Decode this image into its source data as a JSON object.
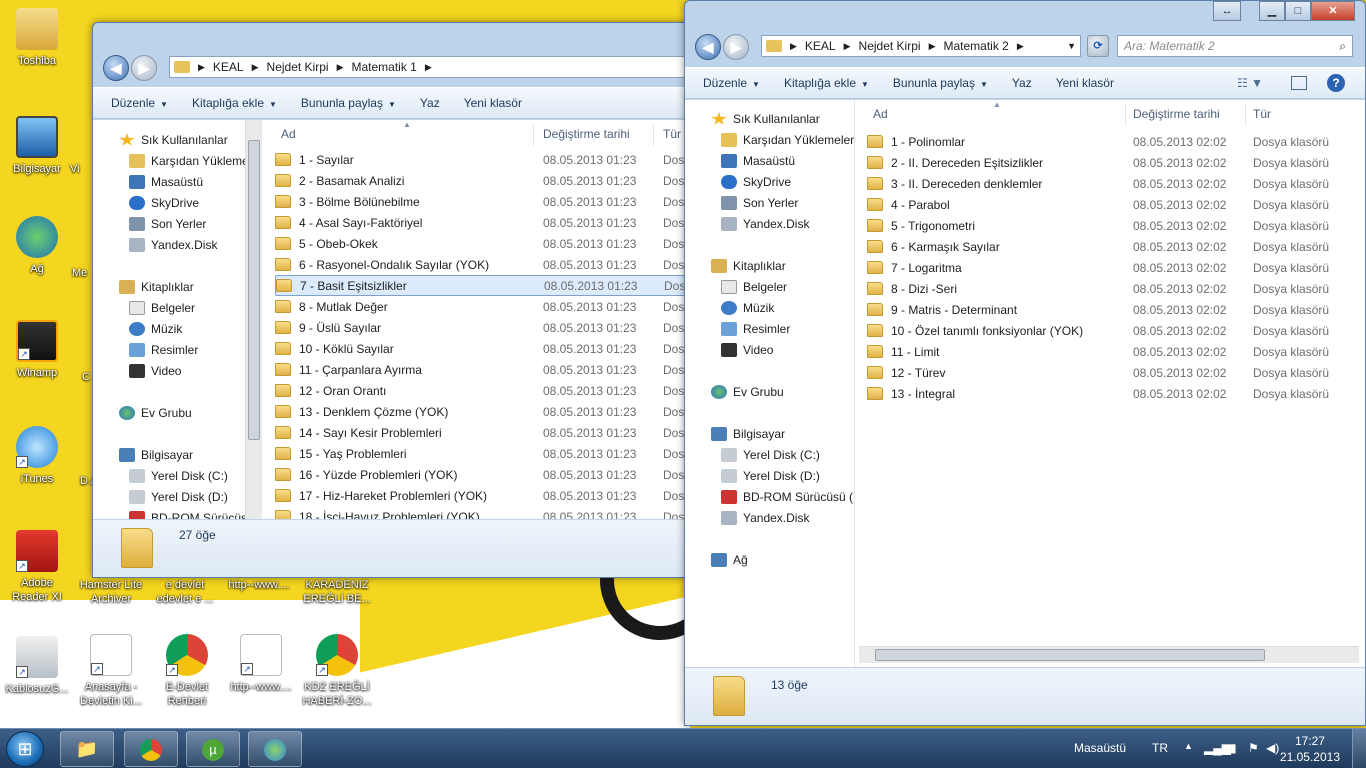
{
  "desktop": {
    "icons_left": [
      {
        "label": "Toshiba",
        "icon": "user-folder-icon"
      },
      {
        "label": "Bilgisayar",
        "icon": "computer-icon"
      },
      {
        "label": "Ağ",
        "icon": "network-icon"
      },
      {
        "label": "Winamp",
        "icon": "winamp-icon"
      },
      {
        "label": "iTunes",
        "icon": "itunes-icon"
      },
      {
        "label": "Adobe Reader XI",
        "icon": "pdf-icon"
      },
      {
        "label": "KablosuzG...",
        "icon": "wireless-icon"
      }
    ],
    "icons_bottom": [
      {
        "label": "Hamster Lite Archiver",
        "icon": "archive-icon"
      },
      {
        "label": "e devlet edevlet e ...",
        "icon": "shortcut-icon"
      },
      {
        "label": "http--www....",
        "icon": "web-shortcut-icon"
      },
      {
        "label": "KARADENIZ EREĞLİ BE...",
        "icon": "web-shortcut-icon"
      },
      {
        "label": "Anasayfa - Devletin Ki...",
        "icon": "web-shortcut-icon"
      },
      {
        "label": "E-Devlet Rehberi",
        "icon": "chrome-icon"
      },
      {
        "label": "http--www....",
        "icon": "web-shortcut-icon"
      },
      {
        "label": "KDZ EREĞLİ HABERİ-ZO...",
        "icon": "chrome-icon"
      }
    ],
    "partial_labels": [
      "Vi",
      "Me",
      "C",
      "D A"
    ]
  },
  "window1": {
    "breadcrumb": [
      "KEAL",
      "Nejdet Kirpi",
      "Matematik 1"
    ],
    "toolbar": [
      "Düzenle",
      "Kitaplığa ekle",
      "Bununla paylaş",
      "Yaz",
      "Yeni klasör"
    ],
    "nav": {
      "favorites_label": "Sık Kullanılanlar",
      "favorites": [
        "Karşıdan Yükleme",
        "Masaüstü",
        "SkyDrive",
        "Son Yerler",
        "Yandex.Disk"
      ],
      "libraries_label": "Kitaplıklar",
      "libraries": [
        "Belgeler",
        "Müzik",
        "Resimler",
        "Video"
      ],
      "homegroup_label": "Ev Grubu",
      "computer_label": "Bilgisayar",
      "computer": [
        "Yerel Disk (C:)",
        "Yerel Disk (D:)",
        "BD-ROM Sürücüsü"
      ]
    },
    "columns": {
      "name": "Ad",
      "date": "Değiştirme tarihi",
      "type": "Tür"
    },
    "rows": [
      {
        "name": "1 - Sayılar",
        "date": "08.05.2013 01:23",
        "type": "Dos"
      },
      {
        "name": "2 - Basamak Analizi",
        "date": "08.05.2013 01:23",
        "type": "Dos"
      },
      {
        "name": "3 - Bölme Bölünebilme",
        "date": "08.05.2013 01:23",
        "type": "Dos"
      },
      {
        "name": "4 - Asal Sayı-Faktöriyel",
        "date": "08.05.2013 01:23",
        "type": "Dos"
      },
      {
        "name": "5 - Obeb-Okek",
        "date": "08.05.2013 01:23",
        "type": "Dos"
      },
      {
        "name": "6 - Rasyonel-Ondalık Sayılar  (YOK)",
        "date": "08.05.2013 01:23",
        "type": "Dos"
      },
      {
        "name": "7 - Basit Eşitsizlikler",
        "date": "08.05.2013 01:23",
        "type": "Dos"
      },
      {
        "name": "8 - Mutlak Değer",
        "date": "08.05.2013 01:23",
        "type": "Dos"
      },
      {
        "name": "9 - Üslü Sayılar",
        "date": "08.05.2013 01:23",
        "type": "Dos"
      },
      {
        "name": "10 - Köklü Sayılar",
        "date": "08.05.2013 01:23",
        "type": "Dos"
      },
      {
        "name": "11 - Çarpanlara Ayırma",
        "date": "08.05.2013 01:23",
        "type": "Dos"
      },
      {
        "name": "12 - Oran Orantı",
        "date": "08.05.2013 01:23",
        "type": "Dos"
      },
      {
        "name": "13 - Denklem Çözme  (YOK)",
        "date": "08.05.2013 01:23",
        "type": "Dos"
      },
      {
        "name": "14 - Sayı Kesir Problemleri",
        "date": "08.05.2013 01:23",
        "type": "Dos"
      },
      {
        "name": "15 - Yaş Problemleri",
        "date": "08.05.2013 01:23",
        "type": "Dos"
      },
      {
        "name": "16 - Yüzde Problemleri (YOK)",
        "date": "08.05.2013 01:23",
        "type": "Dos"
      },
      {
        "name": "17 - Hiz-Hareket Problemleri  (YOK)",
        "date": "08.05.2013 01:23",
        "type": "Dos"
      },
      {
        "name": "18 - İşçi-Havuz Problemleri  (YOK)",
        "date": "08.05.2013 01:23",
        "type": "Dos"
      }
    ],
    "selected_row": "7 - Basit Eşitsizlikler",
    "status": "27 öğe"
  },
  "window2": {
    "breadcrumb": [
      "KEAL",
      "Nejdet Kirpi",
      "Matematik 2"
    ],
    "search_placeholder": "Ara: Matematik 2",
    "toolbar": [
      "Düzenle",
      "Kitaplığa ekle",
      "Bununla paylaş",
      "Yaz",
      "Yeni klasör"
    ],
    "nav": {
      "favorites_label": "Sık Kullanılanlar",
      "favorites": [
        "Karşıdan Yüklemeler",
        "Masaüstü",
        "SkyDrive",
        "Son Yerler",
        "Yandex.Disk"
      ],
      "libraries_label": "Kitaplıklar",
      "libraries": [
        "Belgeler",
        "Müzik",
        "Resimler",
        "Video"
      ],
      "homegroup_label": "Ev Grubu",
      "computer_label": "Bilgisayar",
      "computer": [
        "Yerel Disk (C:)",
        "Yerel Disk (D:)",
        "BD-ROM Sürücüsü (F",
        "Yandex.Disk"
      ],
      "network_label": "Ağ"
    },
    "columns": {
      "name": "Ad",
      "date": "Değiştirme tarihi",
      "type": "Tür"
    },
    "rows": [
      {
        "name": "1 - Polinomlar",
        "date": "08.05.2013 02:02",
        "type": "Dosya klasörü"
      },
      {
        "name": "2 - II. Dereceden Eşitsizlikler",
        "date": "08.05.2013 02:02",
        "type": "Dosya klasörü"
      },
      {
        "name": "3 - II. Dereceden denklemler",
        "date": "08.05.2013 02:02",
        "type": "Dosya klasörü"
      },
      {
        "name": "4 - Parabol",
        "date": "08.05.2013 02:02",
        "type": "Dosya klasörü"
      },
      {
        "name": "5 - Trigonometri",
        "date": "08.05.2013 02:02",
        "type": "Dosya klasörü"
      },
      {
        "name": "6 - Karmaşık Sayılar",
        "date": "08.05.2013 02:02",
        "type": "Dosya klasörü"
      },
      {
        "name": "7 - Logaritma",
        "date": "08.05.2013 02:02",
        "type": "Dosya klasörü"
      },
      {
        "name": "8 - Dizi -Seri",
        "date": "08.05.2013 02:02",
        "type": "Dosya klasörü"
      },
      {
        "name": "9 - Matris - Determinant",
        "date": "08.05.2013 02:02",
        "type": "Dosya klasörü"
      },
      {
        "name": "10 - Özel tanımlı fonksiyonlar (YOK)",
        "date": "08.05.2013 02:02",
        "type": "Dosya klasörü"
      },
      {
        "name": "11 - Limit",
        "date": "08.05.2013 02:02",
        "type": "Dosya klasörü"
      },
      {
        "name": "12 - Türev",
        "date": "08.05.2013 02:02",
        "type": "Dosya klasörü"
      },
      {
        "name": "13 - İntegral",
        "date": "08.05.2013 02:02",
        "type": "Dosya klasörü"
      }
    ],
    "status": "13 öğe"
  },
  "taskbar": {
    "tray_label": "Masaüstü",
    "language": "TR",
    "time": "17:27",
    "date": "21.05.2013"
  }
}
